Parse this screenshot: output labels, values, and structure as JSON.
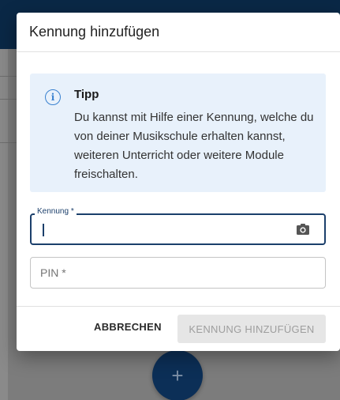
{
  "dialog": {
    "title": "Kennung hinzufügen",
    "tip": {
      "icon": "info-icon",
      "title": "Tipp",
      "text": "Du kannst mit Hilfe einer Kennung, welche du von deiner Musikschule erhalten kannst, weiteren Unterricht oder weitere Module freischalten."
    },
    "kennung_field": {
      "label": "Kennung *",
      "value": "",
      "icon": "camera-icon"
    },
    "pin_field": {
      "placeholder": "PIN *",
      "value": ""
    },
    "buttons": {
      "cancel": "ABBRECHEN",
      "add": "KENNUNG HINZUFÜGEN"
    }
  },
  "background": {
    "fab_label": "+"
  },
  "colors": {
    "primary": "#1b3f6b",
    "tip_bg": "#e8f1fb",
    "info_blue": "#3a82d0",
    "disabled_button": "#e6e6e6"
  }
}
